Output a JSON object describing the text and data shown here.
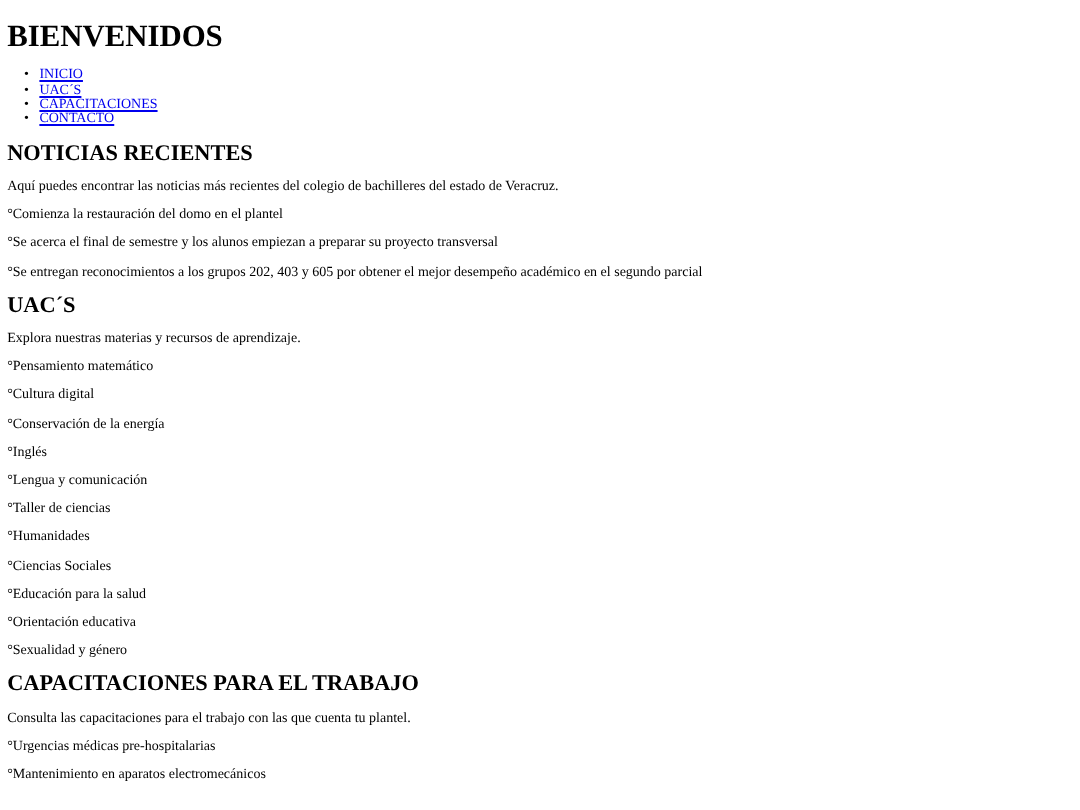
{
  "title": "BIENVENIDOS",
  "nav": [
    {
      "bullet": "•",
      "label": "INICIO"
    },
    {
      "bullet": "•",
      "label": "UAC´S"
    },
    {
      "bullet": "•",
      "label": "CAPACITACIONES"
    },
    {
      "bullet": "•",
      "label": "CONTACTO"
    }
  ],
  "sections": [
    {
      "heading": "NOTICIAS RECIENTES",
      "intro": "Aquí puedes encontrar las noticias más recientes del colegio de bachilleres del estado de Veracruz.",
      "items": [
        "°Comienza la restauración del domo en el plantel",
        "°Se acerca el final de semestre y los alunos empiezan a preparar su proyecto transversal",
        "°Se entregan reconocimientos a los grupos 202, 403 y 605 por obtener el mejor desempeño académico en el segundo parcial"
      ]
    },
    {
      "heading": "UAC´S",
      "intro": "Explora nuestras materias y recursos de aprendizaje.",
      "items": [
        "°Pensamiento matemático",
        "°Cultura digital",
        "°Conservación de la energía",
        "°Inglés",
        "°Lengua y comunicación",
        "°Taller de ciencias",
        "°Humanidades",
        "°Ciencias Sociales",
        "°Educación para la salud",
        "°Orientación educativa",
        "°Sexualidad y género"
      ]
    },
    {
      "heading": "CAPACITACIONES PARA EL TRABAJO",
      "intro": "Consulta las capacitaciones para el trabajo con las que cuenta tu plantel.",
      "items": [
        "°Urgencias médicas pre-hospitalarias",
        "°Mantenimiento en aparatos electromecánicos"
      ]
    }
  ]
}
